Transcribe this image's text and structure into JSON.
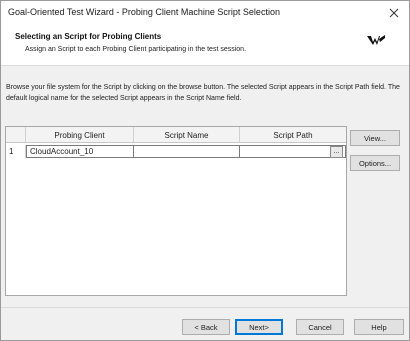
{
  "window": {
    "title": "Goal-Oriented Test Wizard - Probing Client Machine Script Selection",
    "close_glyph": "✕"
  },
  "header": {
    "title": "Selecting an Script for Probing Clients",
    "subtitle": "Assign an Script to each Probing Client participating in the test session.",
    "logo_icon": "brand-logo-icon"
  },
  "instructions": "Browse your file system for the Script by clicking on the browse button. The selected Script appears in the Script Path field. The default logical name for the selected Script appears in the Script Name field.",
  "grid": {
    "columns": [
      "",
      "Probing Client",
      "Script Name",
      "Script Path"
    ],
    "rows": [
      {
        "index": "1",
        "probing_client": "CloudAccount_10",
        "script_name": "",
        "script_path": "",
        "browse_label": "..."
      }
    ]
  },
  "side_buttons": {
    "view": "View...",
    "options": "Options..."
  },
  "footer": {
    "back": "< Back",
    "next": "Next>",
    "cancel": "Cancel",
    "help": "Help"
  },
  "colors": {
    "accent": "#0078d7",
    "window_bg": "#f0f0f0"
  }
}
